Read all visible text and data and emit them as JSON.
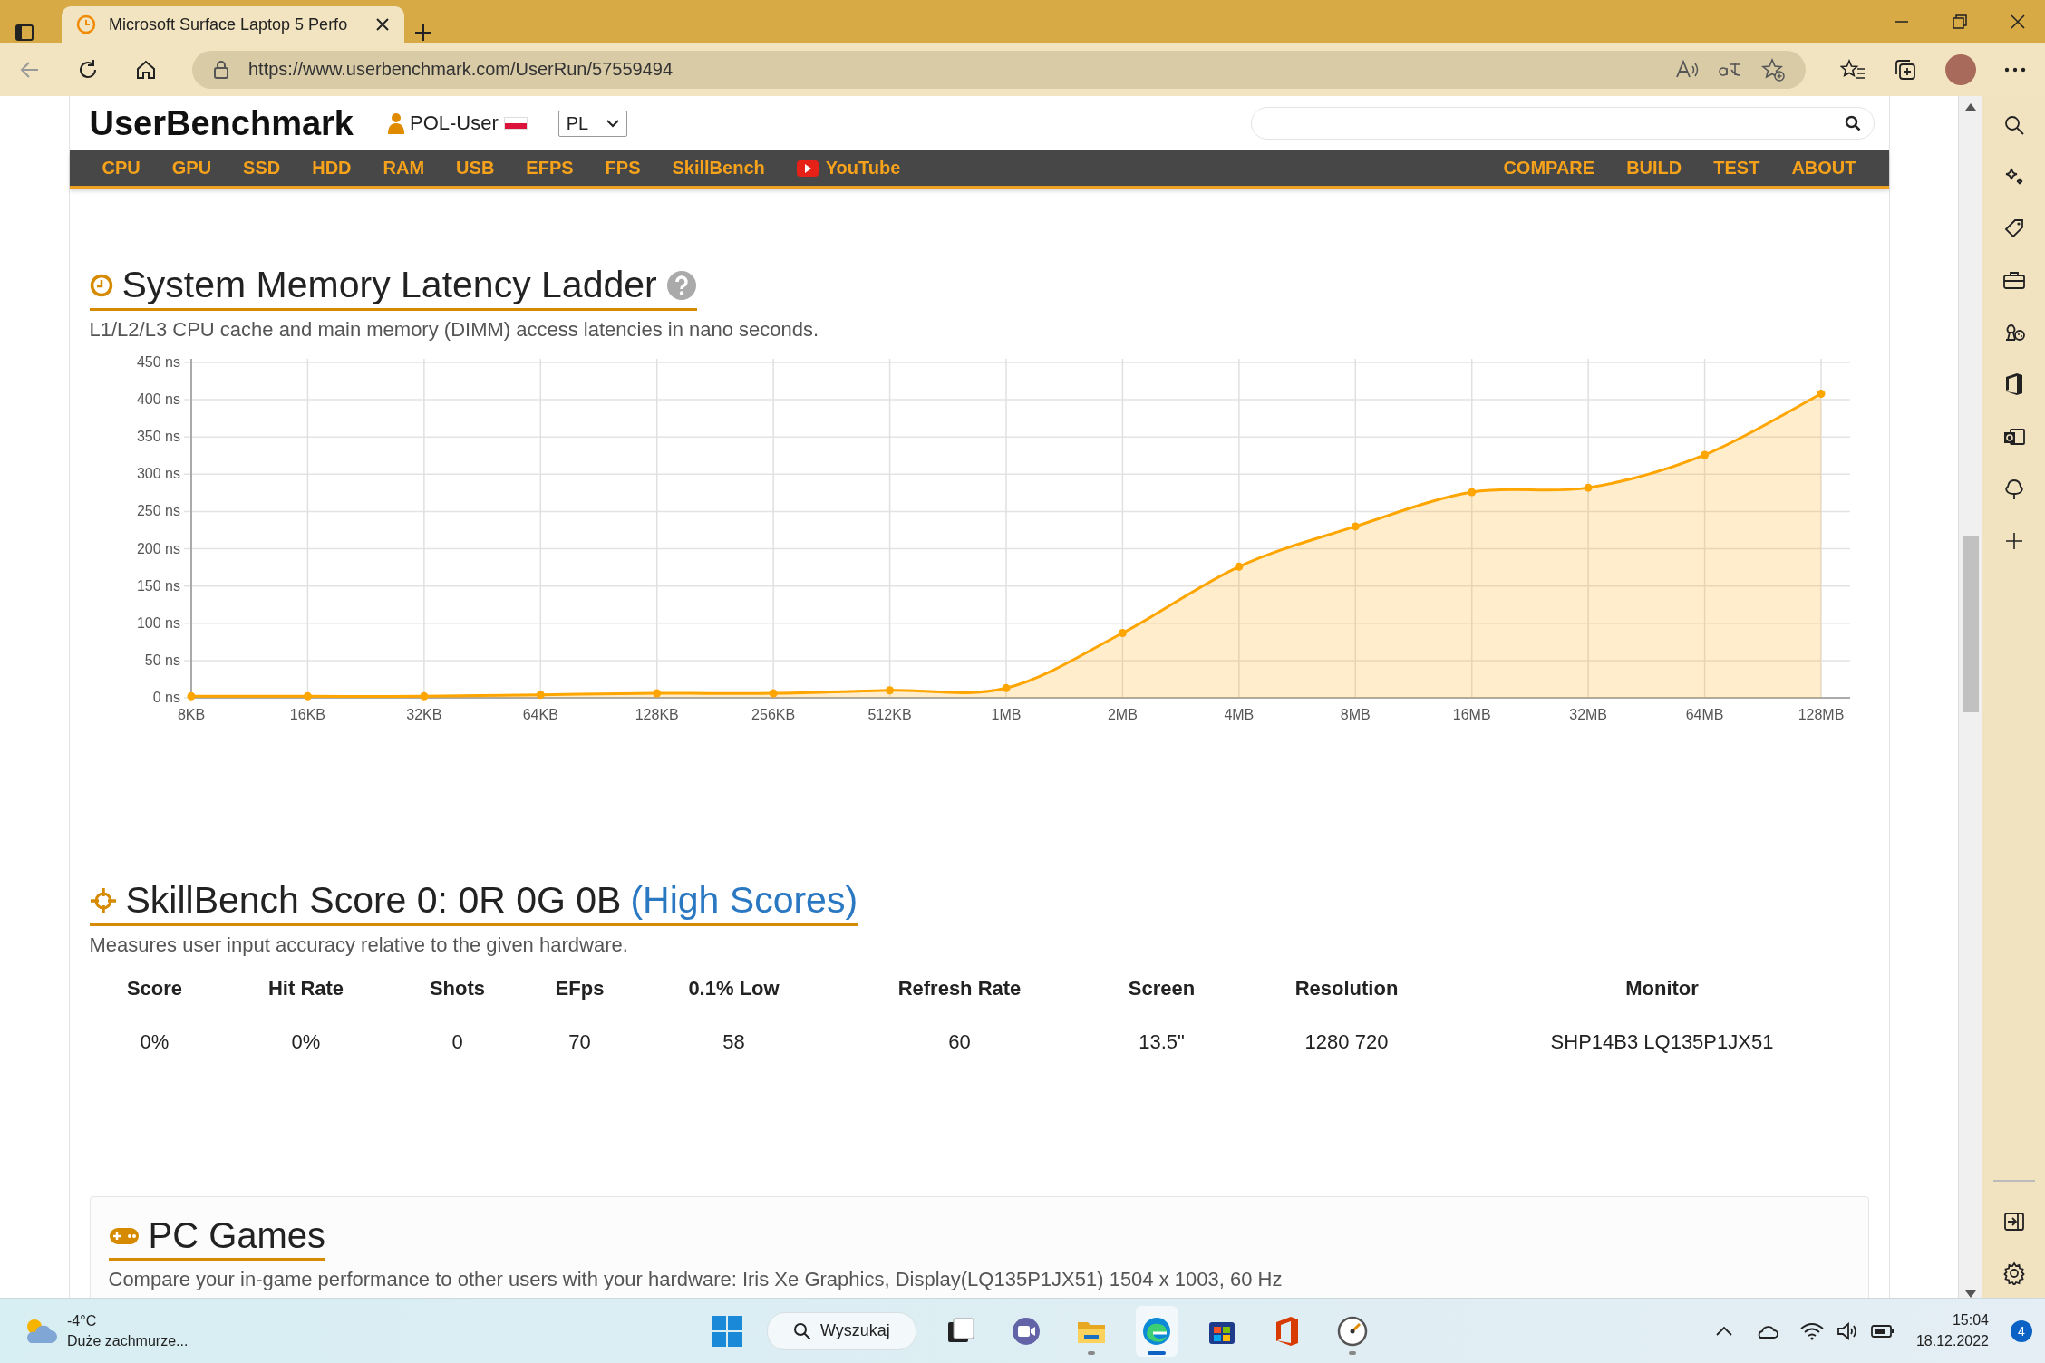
{
  "browser": {
    "tab_title": "Microsoft Surface Laptop 5 Perfo",
    "url": "https://www.userbenchmark.com/UserRun/57559494"
  },
  "site": {
    "logo": "UserBenchmark",
    "user": "POL-User",
    "language": "PL",
    "nav_left": [
      "CPU",
      "GPU",
      "SSD",
      "HDD",
      "RAM",
      "USB",
      "EFPS",
      "FPS",
      "SkillBench"
    ],
    "youtube": "YouTube",
    "nav_right": [
      "COMPARE",
      "BUILD",
      "TEST",
      "ABOUT"
    ]
  },
  "latency": {
    "title": "System Memory Latency Ladder",
    "description": "L1/L2/L3 CPU cache and main memory (DIMM) access latencies in nano seconds.",
    "chart_data": {
      "type": "area",
      "categories": [
        "8KB",
        "16KB",
        "32KB",
        "64KB",
        "128KB",
        "256KB",
        "512KB",
        "1MB",
        "2MB",
        "4MB",
        "8MB",
        "16MB",
        "32MB",
        "64MB",
        "128MB"
      ],
      "series": [
        {
          "color": "#ffa500",
          "values": [
            2,
            2,
            2,
            4,
            6,
            6,
            10,
            13,
            87,
            176,
            230,
            276,
            282,
            326,
            408
          ]
        }
      ],
      "ylim": [
        0,
        450
      ],
      "grid": true,
      "yticks": [
        {
          "value": 0,
          "label": "0 ns"
        },
        {
          "value": 50,
          "label": "50 ns"
        },
        {
          "value": 100,
          "label": "100 ns"
        },
        {
          "value": 150,
          "label": "150 ns"
        },
        {
          "value": 200,
          "label": "200 ns"
        },
        {
          "value": 250,
          "label": "250 ns"
        },
        {
          "value": 300,
          "label": "300 ns"
        },
        {
          "value": 350,
          "label": "350 ns"
        },
        {
          "value": 400,
          "label": "400 ns"
        },
        {
          "value": 450,
          "label": "450 ns"
        }
      ]
    }
  },
  "skillbench": {
    "title": "SkillBench Score 0: 0R 0G 0B",
    "link": "(High Scores)",
    "description": "Measures user input accuracy relative to the given hardware.",
    "columns": [
      "Score",
      "Hit Rate",
      "Shots",
      "EFps",
      "0.1% Low",
      "Refresh Rate",
      "Screen",
      "Resolution",
      "Monitor"
    ],
    "values": [
      "0%",
      "0%",
      "0",
      "70",
      "58",
      "60",
      "13.5\"",
      "1280 720",
      "SHP14B3 LQ135P1JX51"
    ]
  },
  "games": {
    "title": "PC Games",
    "description": "Compare your in-game performance to other users with your hardware: Iris Xe Graphics, Display(LQ135P1JX51) 1504 x 1003, 60 Hz"
  },
  "taskbar": {
    "temperature": "-4°C",
    "weather": "Duże zachmurze...",
    "search": "Wyszukaj",
    "apps": [
      {
        "kind": "task-view",
        "running": false,
        "selected": false
      },
      {
        "kind": "chat",
        "running": false,
        "selected": false
      },
      {
        "kind": "folder",
        "running": true,
        "selected": false
      },
      {
        "kind": "browser",
        "running": true,
        "selected": true
      },
      {
        "kind": "store",
        "running": false,
        "selected": false
      },
      {
        "kind": "office",
        "running": false,
        "selected": false
      },
      {
        "kind": "gauge",
        "running": true,
        "selected": false
      }
    ],
    "time": "15:04",
    "date": "18.12.2022",
    "notifications": "4"
  }
}
